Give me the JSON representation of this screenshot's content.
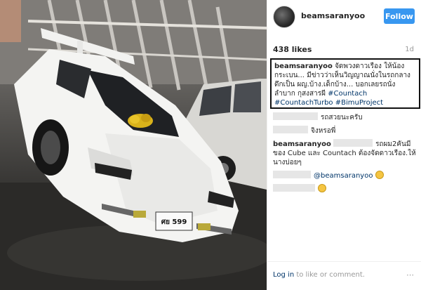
{
  "header": {
    "username": "beamsaranyoo",
    "follow_label": "Follow"
  },
  "post": {
    "likes": "438 likes",
    "age": "1d",
    "caption": {
      "username": "beamsaranyoo",
      "text": "จัดพวงดาวเรือง ให้น้องกระเบน... มีข่าวว่าเห็นวิญญาณนั่งในรถกลางดึกเป็น ผญ.บ้าง.เด็กบ้าง... บอกเลยรถนั่งลำบาก กุสงสารผี",
      "tags": [
        "#Countach",
        "#CountachTurbo",
        "#BimuProject"
      ]
    },
    "plate": {
      "number": "ศย 599"
    }
  },
  "comments": [
    {
      "username": "",
      "text": "รถสวยนะครับ"
    },
    {
      "username": "",
      "text": "จิงหรอพี่"
    },
    {
      "username": "beamsaranyoo",
      "text": "รถผม2คันมีของ Cube และ Countach ต้องจัดดาวเรือง.ให้นางบ่อยๆ"
    },
    {
      "username": "",
      "mention": "@beamsaranyoo",
      "emoji": "grinning-face-emoji"
    },
    {
      "username": "",
      "emoji": "fearful-face-emoji"
    }
  ],
  "footer": {
    "login_link": "Log in",
    "login_rest": " to like or comment.",
    "more_icon": "⋯"
  }
}
